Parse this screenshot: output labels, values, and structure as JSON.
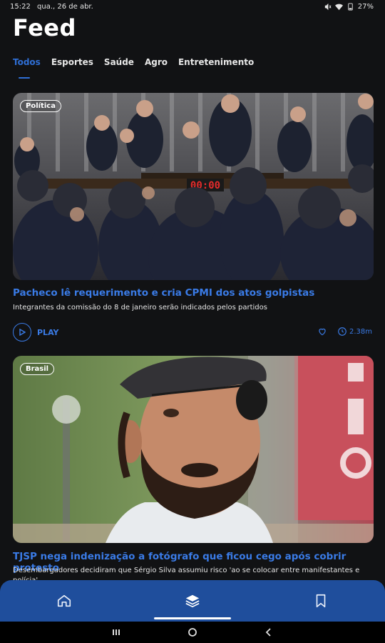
{
  "status": {
    "time": "15:22",
    "date": "qua., 26 de abr.",
    "battery": "27%"
  },
  "page": {
    "title": "Feed"
  },
  "tabs": [
    {
      "label": "Todos",
      "active": true
    },
    {
      "label": "Esportes"
    },
    {
      "label": "Saúde"
    },
    {
      "label": "Agro"
    },
    {
      "label": "Entretenimento"
    }
  ],
  "cards": [
    {
      "category": "Política",
      "title": "Pacheco lê requerimento e cria CPMI dos atos golpistas",
      "subtitle": "Integrantes da comissão do 8 de janeiro serão indicados pelos partidos",
      "play_label": "PLAY",
      "duration": "2.38m",
      "clock_display": "00:00"
    },
    {
      "category": "Brasil",
      "title": "TJSP nega indenização a fotógrafo que ficou cego após cobrir protesto",
      "subtitle": "Desembargadores decidiram que Sérgio Silva assumiu risco 'ao se colocar entre manifestantes e polícia'"
    }
  ],
  "colors": {
    "accent": "#2f6fd6",
    "nav_bg": "#1f4e9c",
    "background": "#111214"
  },
  "icons": [
    "home-icon",
    "feed-layers-icon",
    "bookmark-icon",
    "play-icon",
    "heart-icon",
    "clock-icon"
  ]
}
